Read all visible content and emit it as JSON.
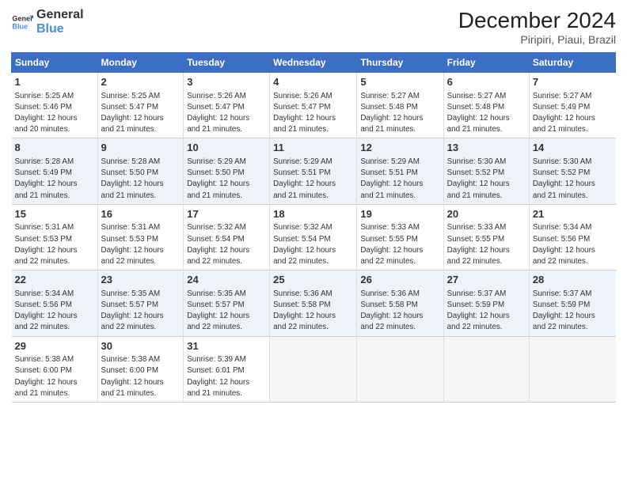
{
  "header": {
    "logo_general": "General",
    "logo_blue": "Blue",
    "month": "December 2024",
    "location": "Piripiri, Piaui, Brazil"
  },
  "days_of_week": [
    "Sunday",
    "Monday",
    "Tuesday",
    "Wednesday",
    "Thursday",
    "Friday",
    "Saturday"
  ],
  "weeks": [
    [
      {
        "day": 1,
        "info": "Sunrise: 5:25 AM\nSunset: 5:46 PM\nDaylight: 12 hours\nand 20 minutes."
      },
      {
        "day": 2,
        "info": "Sunrise: 5:25 AM\nSunset: 5:47 PM\nDaylight: 12 hours\nand 21 minutes."
      },
      {
        "day": 3,
        "info": "Sunrise: 5:26 AM\nSunset: 5:47 PM\nDaylight: 12 hours\nand 21 minutes."
      },
      {
        "day": 4,
        "info": "Sunrise: 5:26 AM\nSunset: 5:47 PM\nDaylight: 12 hours\nand 21 minutes."
      },
      {
        "day": 5,
        "info": "Sunrise: 5:27 AM\nSunset: 5:48 PM\nDaylight: 12 hours\nand 21 minutes."
      },
      {
        "day": 6,
        "info": "Sunrise: 5:27 AM\nSunset: 5:48 PM\nDaylight: 12 hours\nand 21 minutes."
      },
      {
        "day": 7,
        "info": "Sunrise: 5:27 AM\nSunset: 5:49 PM\nDaylight: 12 hours\nand 21 minutes."
      }
    ],
    [
      {
        "day": 8,
        "info": "Sunrise: 5:28 AM\nSunset: 5:49 PM\nDaylight: 12 hours\nand 21 minutes."
      },
      {
        "day": 9,
        "info": "Sunrise: 5:28 AM\nSunset: 5:50 PM\nDaylight: 12 hours\nand 21 minutes."
      },
      {
        "day": 10,
        "info": "Sunrise: 5:29 AM\nSunset: 5:50 PM\nDaylight: 12 hours\nand 21 minutes."
      },
      {
        "day": 11,
        "info": "Sunrise: 5:29 AM\nSunset: 5:51 PM\nDaylight: 12 hours\nand 21 minutes."
      },
      {
        "day": 12,
        "info": "Sunrise: 5:29 AM\nSunset: 5:51 PM\nDaylight: 12 hours\nand 21 minutes."
      },
      {
        "day": 13,
        "info": "Sunrise: 5:30 AM\nSunset: 5:52 PM\nDaylight: 12 hours\nand 21 minutes."
      },
      {
        "day": 14,
        "info": "Sunrise: 5:30 AM\nSunset: 5:52 PM\nDaylight: 12 hours\nand 21 minutes."
      }
    ],
    [
      {
        "day": 15,
        "info": "Sunrise: 5:31 AM\nSunset: 5:53 PM\nDaylight: 12 hours\nand 22 minutes."
      },
      {
        "day": 16,
        "info": "Sunrise: 5:31 AM\nSunset: 5:53 PM\nDaylight: 12 hours\nand 22 minutes."
      },
      {
        "day": 17,
        "info": "Sunrise: 5:32 AM\nSunset: 5:54 PM\nDaylight: 12 hours\nand 22 minutes."
      },
      {
        "day": 18,
        "info": "Sunrise: 5:32 AM\nSunset: 5:54 PM\nDaylight: 12 hours\nand 22 minutes."
      },
      {
        "day": 19,
        "info": "Sunrise: 5:33 AM\nSunset: 5:55 PM\nDaylight: 12 hours\nand 22 minutes."
      },
      {
        "day": 20,
        "info": "Sunrise: 5:33 AM\nSunset: 5:55 PM\nDaylight: 12 hours\nand 22 minutes."
      },
      {
        "day": 21,
        "info": "Sunrise: 5:34 AM\nSunset: 5:56 PM\nDaylight: 12 hours\nand 22 minutes."
      }
    ],
    [
      {
        "day": 22,
        "info": "Sunrise: 5:34 AM\nSunset: 5:56 PM\nDaylight: 12 hours\nand 22 minutes."
      },
      {
        "day": 23,
        "info": "Sunrise: 5:35 AM\nSunset: 5:57 PM\nDaylight: 12 hours\nand 22 minutes."
      },
      {
        "day": 24,
        "info": "Sunrise: 5:35 AM\nSunset: 5:57 PM\nDaylight: 12 hours\nand 22 minutes."
      },
      {
        "day": 25,
        "info": "Sunrise: 5:36 AM\nSunset: 5:58 PM\nDaylight: 12 hours\nand 22 minutes."
      },
      {
        "day": 26,
        "info": "Sunrise: 5:36 AM\nSunset: 5:58 PM\nDaylight: 12 hours\nand 22 minutes."
      },
      {
        "day": 27,
        "info": "Sunrise: 5:37 AM\nSunset: 5:59 PM\nDaylight: 12 hours\nand 22 minutes."
      },
      {
        "day": 28,
        "info": "Sunrise: 5:37 AM\nSunset: 5:59 PM\nDaylight: 12 hours\nand 22 minutes."
      }
    ],
    [
      {
        "day": 29,
        "info": "Sunrise: 5:38 AM\nSunset: 6:00 PM\nDaylight: 12 hours\nand 21 minutes."
      },
      {
        "day": 30,
        "info": "Sunrise: 5:38 AM\nSunset: 6:00 PM\nDaylight: 12 hours\nand 21 minutes."
      },
      {
        "day": 31,
        "info": "Sunrise: 5:39 AM\nSunset: 6:01 PM\nDaylight: 12 hours\nand 21 minutes."
      },
      null,
      null,
      null,
      null
    ]
  ]
}
